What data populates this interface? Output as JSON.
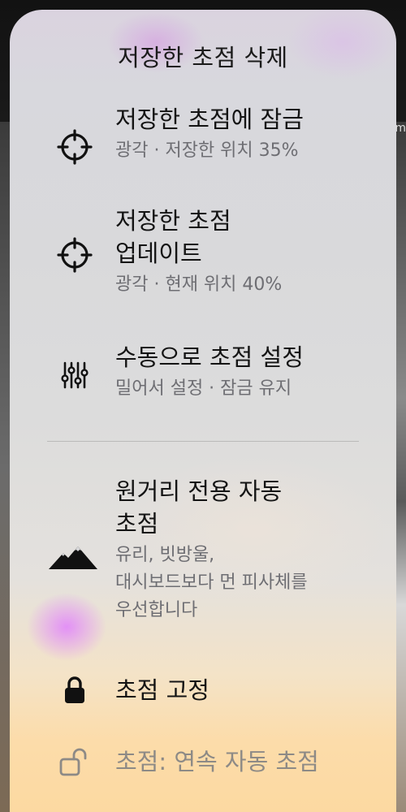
{
  "background": {
    "edge_text": "m"
  },
  "menu": {
    "title": "저장한 초점 삭제",
    "items": [
      {
        "label": "저장한 초점에 잠금",
        "sub": "광각 · 저장한 위치 35%",
        "icon": "crosshair-icon"
      },
      {
        "label_line1": "저장한 초점",
        "label_line2": "업데이트",
        "sub": "광각 · 현재 위치 40%",
        "icon": "crosshair-icon"
      },
      {
        "label": "수동으로 초점 설정",
        "sub": "밀어서 설정 · 잠금 유지",
        "icon": "sliders-icon"
      },
      {
        "label_line1": "원거리 전용 자동",
        "label_line2": "초점",
        "sub_line1": "유리, 빗방울,",
        "sub_line2": "대시보드보다 먼 피사체를",
        "sub_line3": "우선합니다",
        "icon": "mountains-icon"
      },
      {
        "label": "초점 고정",
        "icon": "lock-icon"
      },
      {
        "label": "초점: 연속 자동 초점",
        "icon": "unlock-icon"
      }
    ]
  }
}
